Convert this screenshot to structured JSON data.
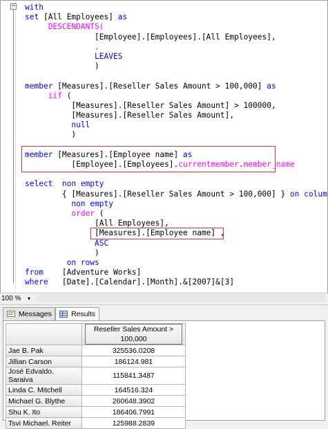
{
  "editor": {
    "collapse_symbol": "−",
    "lines": [
      [
        {
          "t": "with",
          "c": "kw"
        }
      ],
      [
        {
          "t": "set ",
          "c": "kw"
        },
        {
          "t": "[All Employees] "
        },
        {
          "t": "as",
          "c": "kw"
        }
      ],
      [
        {
          "t": "     "
        },
        {
          "t": "DESCENDANTS(",
          "c": "fn"
        }
      ],
      [
        {
          "t": "               [Employee].[Employees].[All Employees],"
        }
      ],
      [
        {
          "t": "               ",
          "c": ""
        },
        {
          "t": ",",
          "c": "gr"
        }
      ],
      [
        {
          "t": "               "
        },
        {
          "t": "LEAVES",
          "c": "kw"
        }
      ],
      [
        {
          "t": "               )"
        }
      ],
      [
        {
          "t": ""
        }
      ],
      [
        {
          "t": "member ",
          "c": "kw"
        },
        {
          "t": "[Measures].[Reseller Sales Amount > 100,000] "
        },
        {
          "t": "as",
          "c": "kw"
        }
      ],
      [
        {
          "t": "     "
        },
        {
          "t": "iif",
          "c": "fn"
        },
        {
          "t": " ("
        }
      ],
      [
        {
          "t": "          [Measures].[Reseller Sales Amount] > 100000,"
        }
      ],
      [
        {
          "t": "          [Measures].[Reseller Sales Amount],"
        }
      ],
      [
        {
          "t": "          "
        },
        {
          "t": "null",
          "c": "kw"
        }
      ],
      [
        {
          "t": "          )"
        }
      ],
      [
        {
          "t": ""
        }
      ],
      [
        {
          "t": "member ",
          "c": "kw"
        },
        {
          "t": "[Measures].[Employee name] "
        },
        {
          "t": "as",
          "c": "kw"
        }
      ],
      [
        {
          "t": "          [Employee].[Employees]."
        },
        {
          "t": "currentmember",
          "c": "fn"
        },
        {
          "t": "."
        },
        {
          "t": "member_name",
          "c": "fn"
        }
      ],
      [
        {
          "t": ""
        }
      ],
      [
        {
          "t": "select  ",
          "c": "kw"
        },
        {
          "t": "non empty",
          "c": "kw"
        }
      ],
      [
        {
          "t": "        { [Measures].[Reseller Sales Amount > 100,000] } "
        },
        {
          "t": "on columns",
          "c": "kw"
        },
        {
          "t": ","
        }
      ],
      [
        {
          "t": "          "
        },
        {
          "t": "non empty",
          "c": "kw"
        }
      ],
      [
        {
          "t": "          "
        },
        {
          "t": "order",
          "c": "fn"
        },
        {
          "t": " ("
        }
      ],
      [
        {
          "t": "               [All Employees],"
        }
      ],
      [
        {
          "t": "               [Measures].[Employee name] ,"
        }
      ],
      [
        {
          "t": "               "
        },
        {
          "t": "ASC",
          "c": "kw"
        }
      ],
      [
        {
          "t": "               )"
        }
      ],
      [
        {
          "t": "         "
        },
        {
          "t": "on rows",
          "c": "kw"
        }
      ],
      [
        {
          "t": "from",
          "c": "kw"
        },
        {
          "t": "    [Adventure Works]"
        }
      ],
      [
        {
          "t": "where",
          "c": "kw"
        },
        {
          "t": "   [Date].[Calendar].[Month].&[2007]&[3]"
        }
      ]
    ]
  },
  "zoom": {
    "value": "100 %",
    "arrow": "▾"
  },
  "tabs": [
    {
      "label": "Messages",
      "icon": "messages-icon"
    },
    {
      "label": "Results",
      "icon": "grid-icon"
    }
  ],
  "grid": {
    "column_header": "Reseller Sales Amount > 100,000",
    "rows": [
      {
        "name": "Jae B. Pak",
        "value": "325536.0208"
      },
      {
        "name": "Jillian Carson",
        "value": "186124.981"
      },
      {
        "name": "José Edvaldo. Saraiva",
        "value": "115841.3487"
      },
      {
        "name": "Linda C. Mitchell",
        "value": "164516.324"
      },
      {
        "name": "Michael G. Blythe",
        "value": "260648.3902"
      },
      {
        "name": "Shu K. Ito",
        "value": "186406.7991"
      },
      {
        "name": "Tsvi Michael. Reiter",
        "value": "125988.2839"
      }
    ]
  },
  "colors": {
    "keyword": "#0000ff",
    "function": "#ff00ff",
    "highlight_box": "#e0302a"
  }
}
